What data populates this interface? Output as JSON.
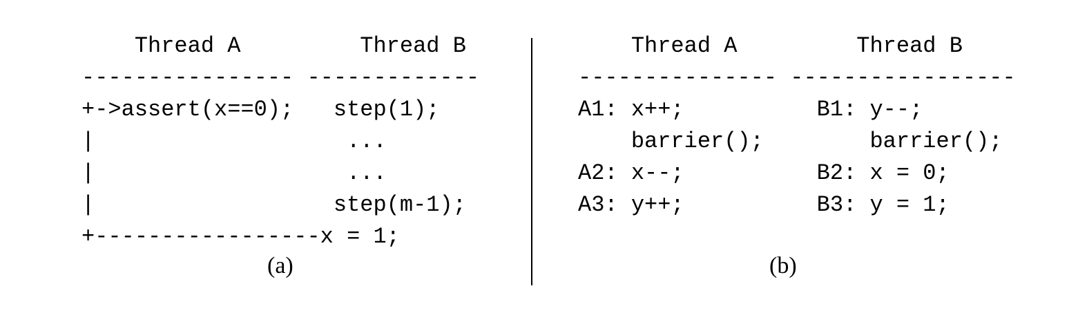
{
  "panel_a": {
    "header": "    Thread A         Thread B",
    "rule": "---------------- -------------",
    "rows": [
      "+->assert(x==0);   step(1);",
      "|                   ...",
      "|                   ...",
      "|                  step(m-1);",
      "+-----------------x = 1;"
    ],
    "caption": "(a)"
  },
  "panel_b": {
    "header": "    Thread A         Thread B",
    "rule": "--------------- -----------------",
    "rows": [
      "A1: x++;          B1: y--;",
      "    barrier();        barrier();",
      "A2: x--;          B2: x = 0;",
      "A3: y++;          B3: y = 1;"
    ],
    "caption": "(b)"
  }
}
